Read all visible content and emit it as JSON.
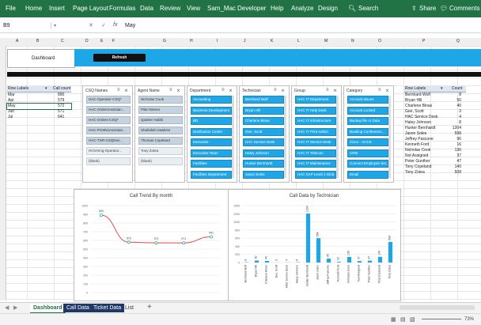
{
  "ribbon": {
    "tabs": [
      "File",
      "Home",
      "Insert",
      "Page Layout",
      "Formulas",
      "Data",
      "Review",
      "View",
      "Sam_Mac",
      "Developer",
      "Help",
      "Analyze",
      "Design"
    ],
    "search": "Search",
    "share": "Share",
    "comments": "Comments"
  },
  "formula_bar": {
    "name_box": "B9",
    "fx": "fx",
    "value": "May"
  },
  "columns": [
    "A",
    "B",
    "C",
    "D",
    "E",
    "F",
    "G",
    "H",
    "I",
    "J",
    "K",
    "L",
    "M",
    "N",
    "O",
    "P",
    "Q"
  ],
  "dashboard": {
    "label": "Dashboard",
    "refresh_label": "Refresh"
  },
  "pivot_left": {
    "header_labels": "Row Labels",
    "header_count": "Call count",
    "rows": [
      {
        "label": "Mar",
        "count": "890"
      },
      {
        "label": "Apr",
        "count": "579"
      },
      {
        "label": "May",
        "count": "572"
      },
      {
        "label": "Jun",
        "count": "571"
      },
      {
        "label": "Jul",
        "count": "641"
      }
    ]
  },
  "slicers": [
    {
      "title": "CSQ Names",
      "style": "grey",
      "items": [
        "HAC-Operator-CSQ*",
        "HAC-OrdersAssistan...",
        "HAC-Orders-CSQ*",
        "HAC-PrintNoAssistan...",
        "HAC-TSR-CSQDev...",
        "HCN-Eng-Operator...",
        "(blank)"
      ]
    },
    {
      "title": "Agent Name",
      "style": "grey",
      "items": [
        "Nicholas Cook",
        "Pilar Nieves",
        "Qadeer Habib",
        "Shahidah Hawkins",
        "Thomas Copeland",
        "Tony Zotea",
        "(blank)"
      ]
    },
    {
      "title": "Department",
      "style": "blue",
      "items": [
        "Accounting",
        "Business Development",
        "BD",
        "Distribution Center",
        "Executive",
        "Executive Team",
        "Facilities",
        "Facilities Department"
      ]
    },
    {
      "title": "Technician",
      "style": "blue",
      "items": [
        "Bernhard Wolf",
        "Bryan Hill",
        "Charlene Binas",
        "Gee, Scott",
        "HAC Service Desk",
        "Haley Johnson",
        "Hunter Bernhardt",
        "Jason Soles"
      ]
    },
    {
      "title": "Group",
      "style": "blue",
      "items": [
        "HAC IT Department",
        "HAC IT Help Desk",
        "HAC IT Infrastructure",
        "HAC IT Print Admin",
        "HAC IT Service Desk",
        "HAC IT Telecom",
        "HAC IT Maintenance",
        "HAC SAP Level 1 Glob..."
      ]
    },
    {
      "title": "Category",
      "style": "blue",
      "items": [
        "Account Issues",
        "Account Locked",
        "Backup file or Data",
        "Booking Conference...",
        "Cisco - VCCE",
        "CRM",
        "Connect Employee Set...",
        "Email"
      ]
    }
  ],
  "pivot_right": {
    "header_labels": "Row Labels",
    "header_count": "Count",
    "rows": [
      {
        "label": "Bernhard Wolf",
        "count": "8"
      },
      {
        "label": "Bryan Hill",
        "count": "50"
      },
      {
        "label": "Charlene Binas",
        "count": "40"
      },
      {
        "label": "Gee, Scott",
        "count": "3"
      },
      {
        "label": "HAC Service Desk",
        "count": "4"
      },
      {
        "label": "Haley Johnson",
        "count": "8"
      },
      {
        "label": "Hunter Bernhardt",
        "count": "1204"
      },
      {
        "label": "Jason Soles",
        "count": "598"
      },
      {
        "label": "Jeffrey Pascone",
        "count": "96"
      },
      {
        "label": "Kenneth Ford",
        "count": "16"
      },
      {
        "label": "Nicholas Cook",
        "count": "136"
      },
      {
        "label": "Not Assigned",
        "count": "37"
      },
      {
        "label": "Peter Gunther",
        "count": "47"
      },
      {
        "label": "Tony Copeland",
        "count": "140"
      },
      {
        "label": "Tony Zotea",
        "count": "508"
      }
    ]
  },
  "chart_data": [
    {
      "type": "line",
      "title": "Call Trend By month",
      "x": [
        "Mar",
        "Apr",
        "May",
        "Jun",
        "Jul"
      ],
      "values": [
        890,
        579,
        572,
        571,
        641
      ],
      "ylim": [
        0,
        1000
      ],
      "yticks": [
        0,
        100,
        200,
        300,
        400,
        500,
        600,
        700,
        800,
        900,
        1000
      ],
      "grid": true
    },
    {
      "type": "bar",
      "title": "Call Data by Technician",
      "categories": [
        "Bernhard Wolf",
        "Bryan Hill",
        "Charlene Binas",
        "Gee, Scott",
        "HAC Service Desk",
        "Haley Johnson",
        "Hunter Bernhardt",
        "Jason Soles",
        "Jeffrey Pascone",
        "Kenneth Ford",
        "Nicholas Cook",
        "Not Assigned",
        "Peter Gunther",
        "Tony Copeland",
        "Tony Zotea"
      ],
      "values": [
        8,
        50,
        40,
        3,
        4,
        8,
        1204,
        598,
        96,
        16,
        136,
        37,
        47,
        140,
        508
      ],
      "ylim": [
        0,
        1400
      ],
      "yticks": [
        0,
        200,
        400,
        600,
        800,
        1000,
        1200,
        1400
      ],
      "grid": true
    }
  ],
  "sheet_tabs": [
    "Dashboard",
    "Call Data",
    "Ticket Data",
    "List"
  ],
  "add_sheet": "+",
  "zoom": "73%",
  "colors": {
    "ribbon": "#217346",
    "accent": "#1fa6e6",
    "line": "#e04a4a",
    "marker": "#34b89a"
  }
}
